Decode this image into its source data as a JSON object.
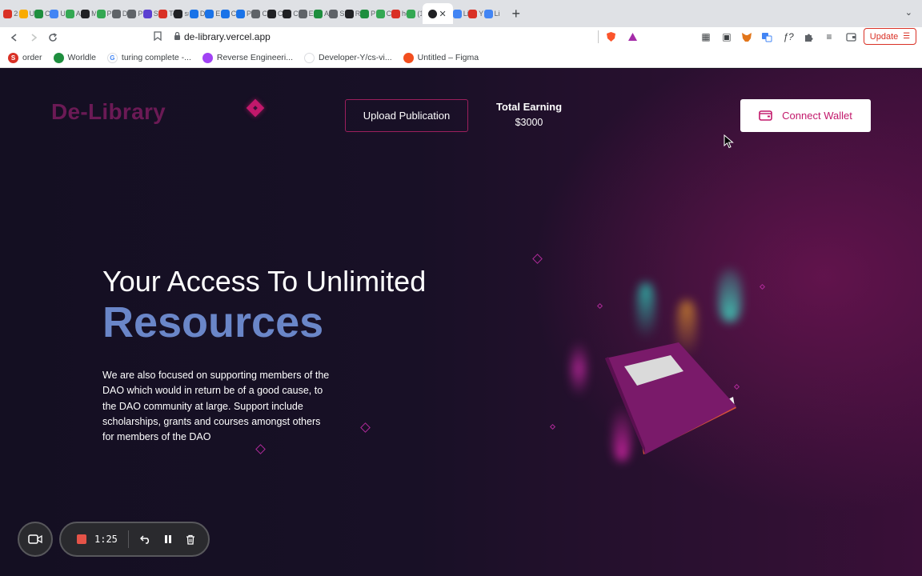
{
  "browser": {
    "tabs": [
      {
        "label": "2m",
        "color": "#d93025"
      },
      {
        "label": "Uc",
        "color": "#f9ab00"
      },
      {
        "label": "Cc",
        "color": "#1e8e3e"
      },
      {
        "label": "Uc",
        "color": "#4285f4"
      },
      {
        "label": "As",
        "color": "#34a853"
      },
      {
        "label": "M",
        "color": "#202124"
      },
      {
        "label": "Pr",
        "color": "#34a853"
      },
      {
        "label": "Dc",
        "color": "#5f6368"
      },
      {
        "label": "Pr",
        "color": "#5f6368"
      },
      {
        "label": "Sc",
        "color": "#5b3fd1"
      },
      {
        "label": "Te",
        "color": "#d93025"
      },
      {
        "label": "su",
        "color": "#202124"
      },
      {
        "label": "Dc",
        "color": "#1a73e8"
      },
      {
        "label": "Et",
        "color": "#1a73e8"
      },
      {
        "label": "Ca",
        "color": "#1a73e8"
      },
      {
        "label": "Pa",
        "color": "#1a73e8"
      },
      {
        "label": "Cc",
        "color": "#5f6368"
      },
      {
        "label": "Cc",
        "color": "#202124"
      },
      {
        "label": "Cc",
        "color": "#202124"
      },
      {
        "label": "Ex",
        "color": "#5f6368"
      },
      {
        "label": "Ac",
        "color": "#1e8e3e"
      },
      {
        "label": "St",
        "color": "#5f6368"
      },
      {
        "label": "Re",
        "color": "#202124"
      },
      {
        "label": "Pr",
        "color": "#1e8e3e"
      },
      {
        "label": "Cc",
        "color": "#34a853"
      },
      {
        "label": "hc",
        "color": "#d93025"
      },
      {
        "label": "(1",
        "color": "#34a853"
      }
    ],
    "tabs_after": [
      {
        "label": "Li",
        "color": "#4285f4"
      },
      {
        "label": "Yc",
        "color": "#d93025"
      },
      {
        "label": "Li",
        "color": "#4285f4"
      }
    ],
    "active_tab_close": "✕",
    "new_tab": "+",
    "tab_search": "⌄",
    "url": "de-library.vercel.app",
    "update_label": "Update",
    "bookmarks": [
      {
        "label": "order",
        "color": "#d93025",
        "glyph": "S"
      },
      {
        "label": "Worldle",
        "color": "#1e8e3e",
        "glyph": ""
      },
      {
        "label": "turing complete -...",
        "color": "#ffffff",
        "glyph": "G"
      },
      {
        "label": "Reverse Engineeri...",
        "color": "#a142f4",
        "glyph": ""
      },
      {
        "label": "Developer-Y/cs-vi...",
        "color": "#ffffff",
        "glyph": ""
      },
      {
        "label": "Untitled – Figma",
        "color": "#f24e1e",
        "glyph": ""
      }
    ]
  },
  "page": {
    "logo": "De-Library",
    "upload_label": "Upload Publication",
    "earning_label": "Total Earning",
    "earning_value": "$3000",
    "connect_label": "Connect Wallet",
    "hero_title_line1": "Your Access To Unlimited",
    "hero_title_line2": "Resources",
    "hero_description": "We are also focused on supporting members of the DAO which would in return be of a good cause, to the DAO community at large. Support include scholarships, grants and courses amongst others for members of the DAO"
  },
  "recorder": {
    "time": "1:25"
  },
  "colors": {
    "accent": "#c2186b",
    "hero_accent": "#6a86c8",
    "logo": "#6b1a55"
  }
}
